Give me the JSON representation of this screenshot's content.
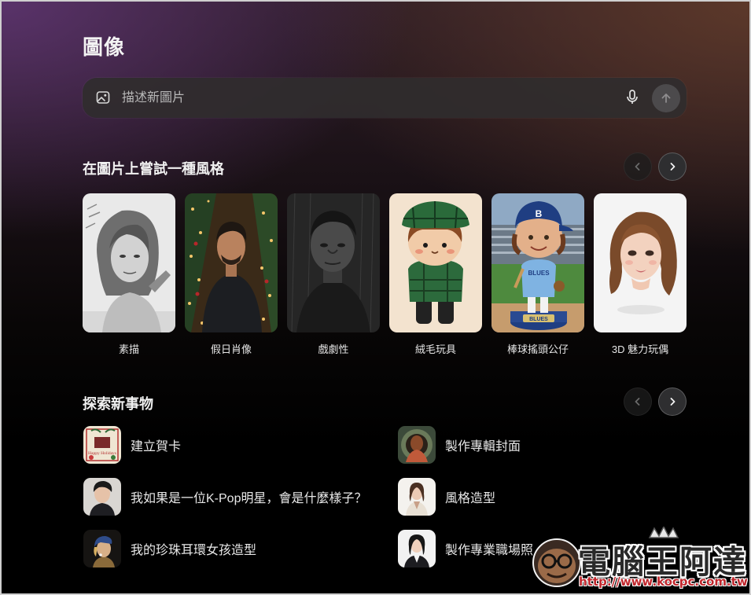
{
  "page": {
    "title": "圖像"
  },
  "search": {
    "placeholder": "描述新圖片"
  },
  "styles_section": {
    "title": "在圖片上嘗試一種風格",
    "cards": [
      {
        "label": "素描"
      },
      {
        "label": "假日肖像"
      },
      {
        "label": "戲劇性"
      },
      {
        "label": "絨毛玩具"
      },
      {
        "label": "棒球搖頭公仔",
        "badge_text": "BLUES"
      },
      {
        "label": "3D 魅力玩偶"
      }
    ]
  },
  "explore_section": {
    "title": "探索新事物",
    "items": [
      {
        "label": "建立賀卡",
        "thumb_text": "Happy Holidays"
      },
      {
        "label": "製作專輯封面"
      },
      {
        "label": "我如果是一位K-Pop明星，會是什麼樣子？"
      },
      {
        "label": "風格造型"
      },
      {
        "label": "我的珍珠耳環女孩造型"
      },
      {
        "label": "製作專業職場照"
      }
    ]
  },
  "watermark": {
    "text": "電腦王阿達",
    "url": "http://www.kocpc.com.tw"
  },
  "colors": {
    "accent_red": "#c1272d",
    "background_dark": "#000000"
  }
}
